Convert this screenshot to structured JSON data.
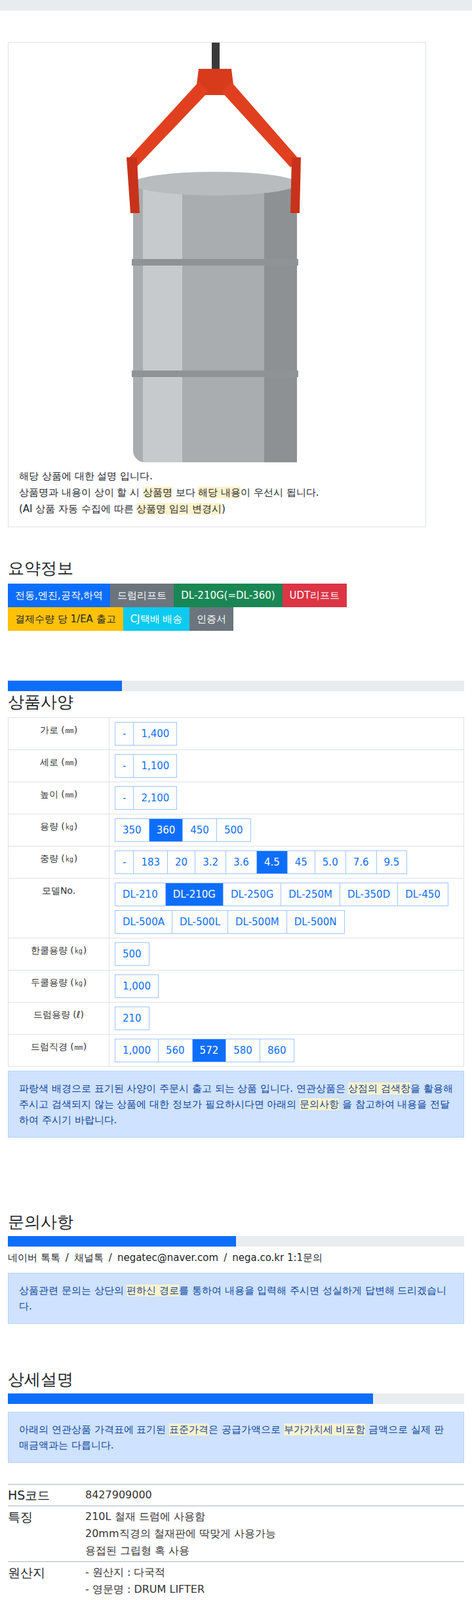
{
  "product_card": {
    "photo": "drum-lifter",
    "notes": [
      [
        {
          "text": "해당 상품에 대한 설명 입니다.",
          "highlight": false
        }
      ],
      [
        {
          "text": "상품명과 내용이 상이 할 시 ",
          "highlight": false
        },
        {
          "text": "상품명",
          "highlight": true
        },
        {
          "text": " 보다 ",
          "highlight": false
        },
        {
          "text": "해당 내용",
          "highlight": true
        },
        {
          "text": "이 우선시 됩니다.",
          "highlight": false
        }
      ],
      [
        {
          "text": "(AI 상품 자동 수집에 따른 ",
          "highlight": false
        },
        {
          "text": "상품명 임의 변경시",
          "highlight": true
        },
        {
          "text": ")",
          "highlight": false
        }
      ]
    ]
  },
  "summary": {
    "title": "요약정보",
    "tag_rows": [
      [
        {
          "label": "전동,엔진,공작,하역",
          "color": "#0d6efd"
        },
        {
          "label": "드럼리프트",
          "color": "#6c757d"
        },
        {
          "label": "DL-210G(=DL-360)",
          "color": "#198754"
        },
        {
          "label": "UDT리프트",
          "color": "#dc3545"
        }
      ],
      [
        {
          "label": "결제수량 당 1/EA 출고",
          "color": "#ffc107"
        },
        {
          "label": "CJ택배 배송",
          "color": "#0dcaf0"
        },
        {
          "label": "인증서",
          "color": "#6c757d"
        }
      ]
    ]
  },
  "specs": {
    "level": 0.25,
    "title": "상품사양",
    "rows": [
      {
        "label": "가로 (㎜)",
        "values": [
          {
            "text": "-",
            "selected": false
          },
          {
            "text": "1,400",
            "selected": false
          }
        ]
      },
      {
        "label": "세로 (㎜)",
        "values": [
          {
            "text": "-",
            "selected": false
          },
          {
            "text": "1,100",
            "selected": false
          }
        ]
      },
      {
        "label": "높이 (㎜)",
        "values": [
          {
            "text": "-",
            "selected": false
          },
          {
            "text": "2,100",
            "selected": false
          }
        ]
      },
      {
        "label": "용량 (㎏)",
        "values": [
          {
            "text": "350",
            "selected": false
          },
          {
            "text": "360",
            "selected": true
          },
          {
            "text": "450",
            "selected": false
          },
          {
            "text": "500",
            "selected": false
          }
        ]
      },
      {
        "label": "중량 (㎏)",
        "values": [
          {
            "text": "-",
            "selected": false
          },
          {
            "text": "183",
            "selected": false
          },
          {
            "text": "20",
            "selected": false
          },
          {
            "text": "3.2",
            "selected": false
          },
          {
            "text": "3.6",
            "selected": false
          },
          {
            "text": "4.5",
            "selected": true
          },
          {
            "text": "45",
            "selected": false
          },
          {
            "text": "5.0",
            "selected": false
          },
          {
            "text": "7.6",
            "selected": false
          },
          {
            "text": "9.5",
            "selected": false
          }
        ]
      },
      {
        "label": "모델No.",
        "values": [
          {
            "text": "DL-210",
            "selected": false
          },
          {
            "text": "DL-210G",
            "selected": true
          },
          {
            "text": "DL-250G",
            "selected": false
          },
          {
            "text": "DL-250M",
            "selected": false
          },
          {
            "text": "DL-350D",
            "selected": false
          },
          {
            "text": "DL-450",
            "selected": false
          },
          {
            "text": "DL-500A",
            "selected": false
          },
          {
            "text": "DL-500L",
            "selected": false
          },
          {
            "text": "DL-500M",
            "selected": false
          },
          {
            "text": "DL-500N",
            "selected": false
          }
        ]
      },
      {
        "label": "한쿨용량 (㎏)",
        "values": [
          {
            "text": "500",
            "selected": false
          }
        ]
      },
      {
        "label": "두쿨용량 (㎏)",
        "values": [
          {
            "text": "1,000",
            "selected": false
          }
        ]
      },
      {
        "label": "드럼용량 (ℓ)",
        "values": [
          {
            "text": "210",
            "selected": false
          }
        ]
      },
      {
        "label": "드럼직경 (㎜)",
        "values": [
          {
            "text": "1,000",
            "selected": false
          },
          {
            "text": "560",
            "selected": false
          },
          {
            "text": "572",
            "selected": true
          },
          {
            "text": "580",
            "selected": false
          },
          {
            "text": "860",
            "selected": false
          }
        ]
      }
    ],
    "notice": [
      {
        "text": "파랑색 배경으로 표기된 사양이 주문시 출고 되는 상품 입니다. 연관상품은 ",
        "highlight": false
      },
      {
        "text": "상점의 검색창",
        "highlight": true
      },
      {
        "text": "을 활용해 주시고 검색되지 않는 상품에 대한 정보가 필요하시다면 아래의 ",
        "highlight": false
      },
      {
        "text": "문의사항",
        "highlight": true
      },
      {
        "text": " 을 참고하여 내용을 전달하여 주시기 바랍니다.",
        "highlight": false
      }
    ]
  },
  "inquiry": {
    "title": "문의사항",
    "level": 0.5,
    "separator": "/",
    "contacts": [
      "네이버 톡톡",
      "채널톡",
      "negatec@naver.com",
      "nega.co.kr 1:1문의"
    ],
    "notice": [
      {
        "text": "상품관련 문의는 상단의 ",
        "highlight": false
      },
      {
        "text": "편하신 경로",
        "highlight": true
      },
      {
        "text": "를 통하여 내용을 입력해 주시면 성실하게 답변해 드리겠습니다.",
        "highlight": false
      }
    ]
  },
  "details": {
    "title": "상세설명",
    "level": 0.8,
    "notice": [
      {
        "text": "아래의 연관상품 가격표에 표기된 ",
        "highlight": false
      },
      {
        "text": "표준가격",
        "highlight": true
      },
      {
        "text": "은 공급가액으로 ",
        "highlight": false
      },
      {
        "text": "부가가치세 비포함",
        "highlight": true
      },
      {
        "text": " 금액으로 실제 판매금액과는 다릅니다.",
        "highlight": false
      }
    ],
    "rows": [
      {
        "label": "HS코드",
        "lines": [
          "8427909000"
        ]
      },
      {
        "label": "특징",
        "lines": [
          "210L 철재 드럼에 사용함",
          "20mm직경의 철재판에 딱맞게 사용가능",
          "용접된 그립형 혹 사용"
        ]
      },
      {
        "label": "원산지",
        "lines": [
          "- 원산지 : 다국적",
          "- 영문명 : DRUM LIFTER"
        ]
      }
    ]
  }
}
